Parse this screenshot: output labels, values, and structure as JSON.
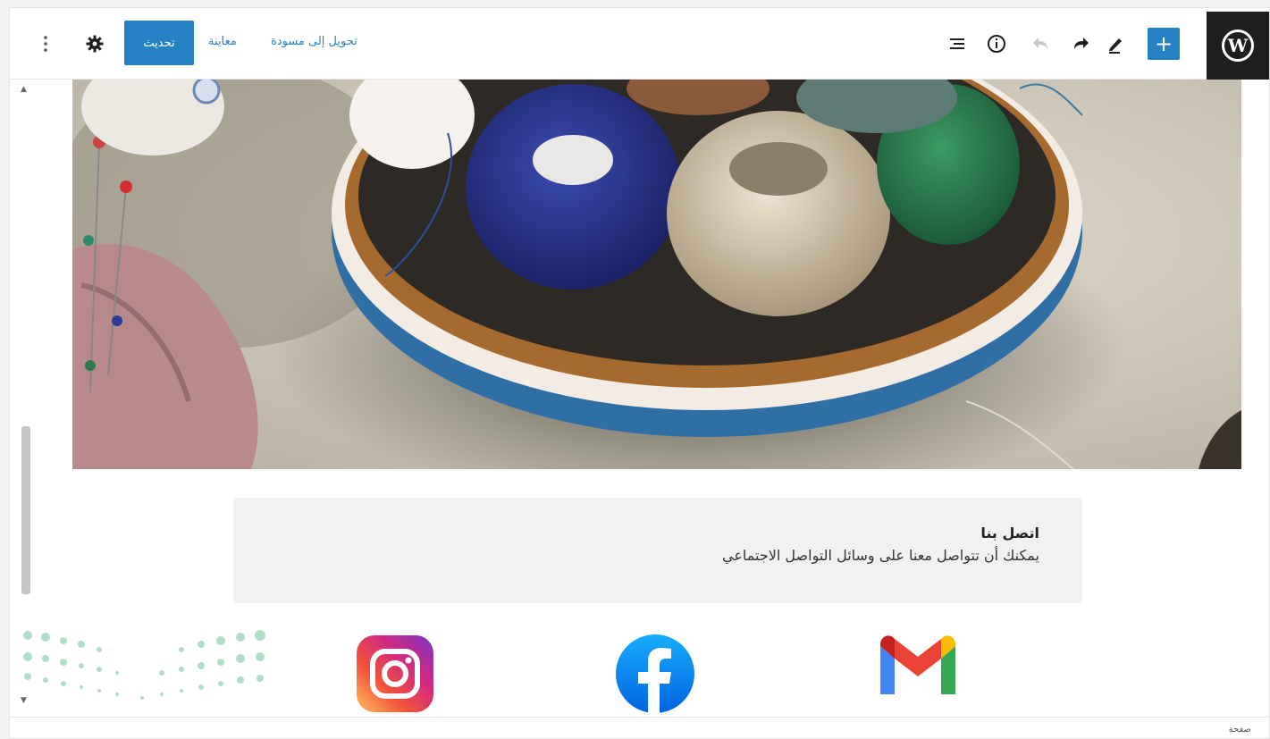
{
  "toolbar": {
    "logo_letter": "W",
    "update_label": "تحديث",
    "preview_label": "معاينة",
    "switch_to_draft_label": "تحويل إلى مسودة",
    "add_symbol": "+"
  },
  "contact": {
    "title": "اتصل بنا",
    "body": "يمكنك أن تتواصل معنا على وسائل التواصل الاجتماعي"
  },
  "footer": {
    "label": "صفحة"
  },
  "colors": {
    "accent": "#2581c4",
    "logo_bg": "#1e1e1e"
  }
}
